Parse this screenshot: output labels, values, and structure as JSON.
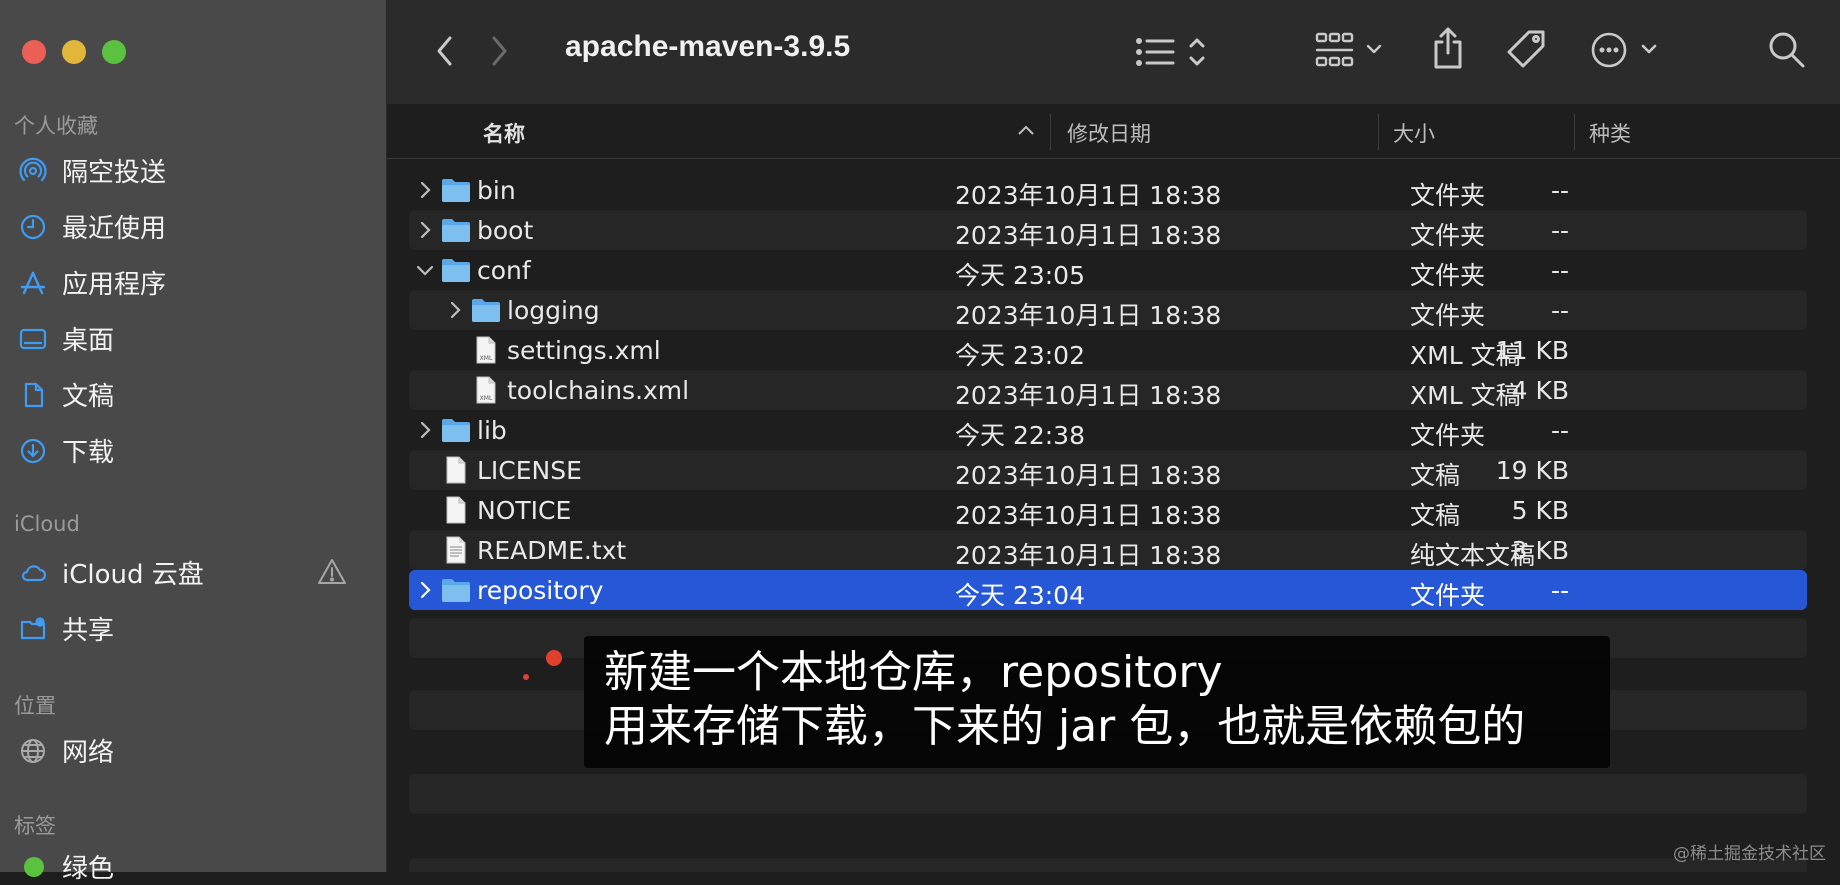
{
  "window": {
    "title": "apache-maven-3.9.5"
  },
  "sidebar": {
    "favorites_header": "个人收藏",
    "favorites": [
      {
        "label": "隔空投送",
        "icon": "airdrop-icon"
      },
      {
        "label": "最近使用",
        "icon": "clock-icon"
      },
      {
        "label": "应用程序",
        "icon": "applications-icon"
      },
      {
        "label": "桌面",
        "icon": "desktop-icon"
      },
      {
        "label": "文稿",
        "icon": "document-icon"
      },
      {
        "label": "下载",
        "icon": "download-icon"
      }
    ],
    "icloud_header": "iCloud",
    "icloud": [
      {
        "label": "iCloud 云盘",
        "icon": "cloud-icon"
      },
      {
        "label": "共享",
        "icon": "shared-folder-icon"
      }
    ],
    "locations_header": "位置",
    "locations": [
      {
        "label": "网络",
        "icon": "globe-icon"
      }
    ],
    "tags_header": "标签",
    "tags": [
      {
        "label": "绿色",
        "color": "#5bc23f"
      }
    ]
  },
  "columns": {
    "name": "名称",
    "date": "修改日期",
    "size": "大小",
    "kind": "种类"
  },
  "files": [
    {
      "name": "bin",
      "date": "2023年10月1日 18:38",
      "size": "--",
      "kind": "文件夹",
      "type": "folder",
      "level": 0,
      "disclosure": "collapsed"
    },
    {
      "name": "boot",
      "date": "2023年10月1日 18:38",
      "size": "--",
      "kind": "文件夹",
      "type": "folder",
      "level": 0,
      "disclosure": "collapsed"
    },
    {
      "name": "conf",
      "date": "今天 23:05",
      "size": "--",
      "kind": "文件夹",
      "type": "folder",
      "level": 0,
      "disclosure": "expanded"
    },
    {
      "name": "logging",
      "date": "2023年10月1日 18:38",
      "size": "--",
      "kind": "文件夹",
      "type": "folder",
      "level": 1,
      "disclosure": "collapsed"
    },
    {
      "name": "settings.xml",
      "date": "今天 23:02",
      "size": "11 KB",
      "kind": "XML 文稿",
      "type": "xml",
      "level": 1,
      "disclosure": "none"
    },
    {
      "name": "toolchains.xml",
      "date": "2023年10月1日 18:38",
      "size": "4 KB",
      "kind": "XML 文稿",
      "type": "xml",
      "level": 1,
      "disclosure": "none"
    },
    {
      "name": "lib",
      "date": "今天 22:38",
      "size": "--",
      "kind": "文件夹",
      "type": "folder",
      "level": 0,
      "disclosure": "collapsed"
    },
    {
      "name": "LICENSE",
      "date": "2023年10月1日 18:38",
      "size": "19 KB",
      "kind": "文稿",
      "type": "doc",
      "level": 0,
      "disclosure": "none"
    },
    {
      "name": "NOTICE",
      "date": "2023年10月1日 18:38",
      "size": "5 KB",
      "kind": "文稿",
      "type": "doc",
      "level": 0,
      "disclosure": "none"
    },
    {
      "name": "README.txt",
      "date": "2023年10月1日 18:38",
      "size": "3 KB",
      "kind": "纯文本文稿",
      "type": "txt",
      "level": 0,
      "disclosure": "none"
    },
    {
      "name": "repository",
      "date": "今天 23:04",
      "size": "--",
      "kind": "文件夹",
      "type": "folder",
      "level": 0,
      "disclosure": "collapsed",
      "selected": true
    }
  ],
  "subtitle": {
    "line1": "新建一个本地仓库，repository",
    "line2": "用来存储下载，下来的 jar 包，也就是依赖包的"
  },
  "watermark": "@稀土掘金技术社区",
  "colors": {
    "selection": "#2557d6",
    "folder": "#5aa9e6",
    "sidebar": "#4a4949"
  }
}
